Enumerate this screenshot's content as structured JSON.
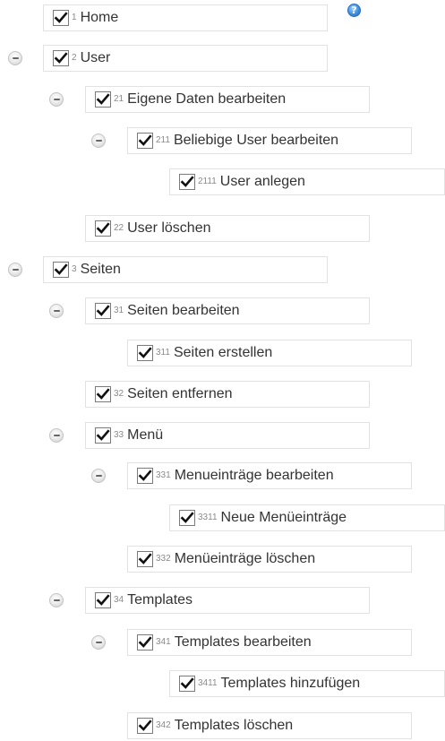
{
  "help_icon": "?",
  "nodes": [
    {
      "num": "1",
      "label": "Home",
      "checked": true,
      "collapsible": false
    },
    {
      "num": "2",
      "label": "User",
      "checked": true,
      "collapsible": true
    },
    {
      "num": "21",
      "label": "Eigene Daten bearbeiten",
      "checked": true,
      "collapsible": true
    },
    {
      "num": "211",
      "label": "Beliebige User bearbeiten",
      "checked": true,
      "collapsible": true
    },
    {
      "num": "2111",
      "label": "User anlegen",
      "checked": true,
      "collapsible": false
    },
    {
      "num": "22",
      "label": "User löschen",
      "checked": true,
      "collapsible": false
    },
    {
      "num": "3",
      "label": "Seiten",
      "checked": true,
      "collapsible": true
    },
    {
      "num": "31",
      "label": "Seiten bearbeiten",
      "checked": true,
      "collapsible": true
    },
    {
      "num": "311",
      "label": "Seiten erstellen",
      "checked": true,
      "collapsible": false
    },
    {
      "num": "32",
      "label": "Seiten entfernen",
      "checked": true,
      "collapsible": false
    },
    {
      "num": "33",
      "label": "Menü",
      "checked": true,
      "collapsible": true
    },
    {
      "num": "331",
      "label": "Menueinträge bearbeiten",
      "checked": true,
      "collapsible": true
    },
    {
      "num": "3311",
      "label": "Neue Menüeinträge",
      "checked": true,
      "collapsible": false
    },
    {
      "num": "332",
      "label": "Menüeinträge löschen",
      "checked": true,
      "collapsible": false
    },
    {
      "num": "34",
      "label": "Templates",
      "checked": true,
      "collapsible": true
    },
    {
      "num": "341",
      "label": "Templates bearbeiten",
      "checked": true,
      "collapsible": true
    },
    {
      "num": "3411",
      "label": "Templates hinzufügen",
      "checked": true,
      "collapsible": false
    },
    {
      "num": "342",
      "label": "Templates löschen",
      "checked": true,
      "collapsible": false
    }
  ]
}
